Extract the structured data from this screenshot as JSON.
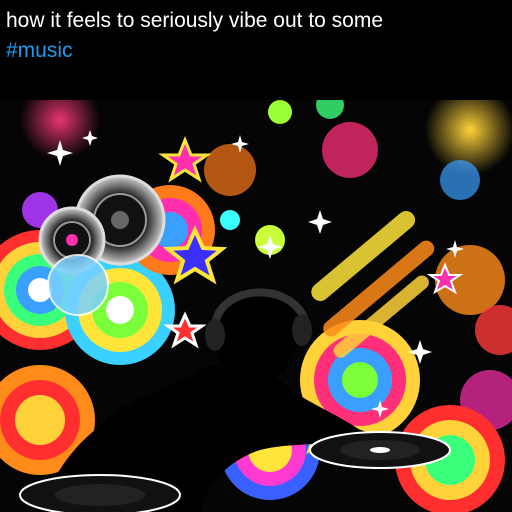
{
  "post": {
    "text": "how it feels to seriously vibe out to some",
    "hashtag": "#music"
  },
  "colors": {
    "background": "#000000",
    "text": "#ffffff",
    "hashtag": "#1d9bf0"
  },
  "media": {
    "icons": [
      "speaker-icon",
      "headphones-icon",
      "turntable-icon",
      "star-icon"
    ]
  }
}
